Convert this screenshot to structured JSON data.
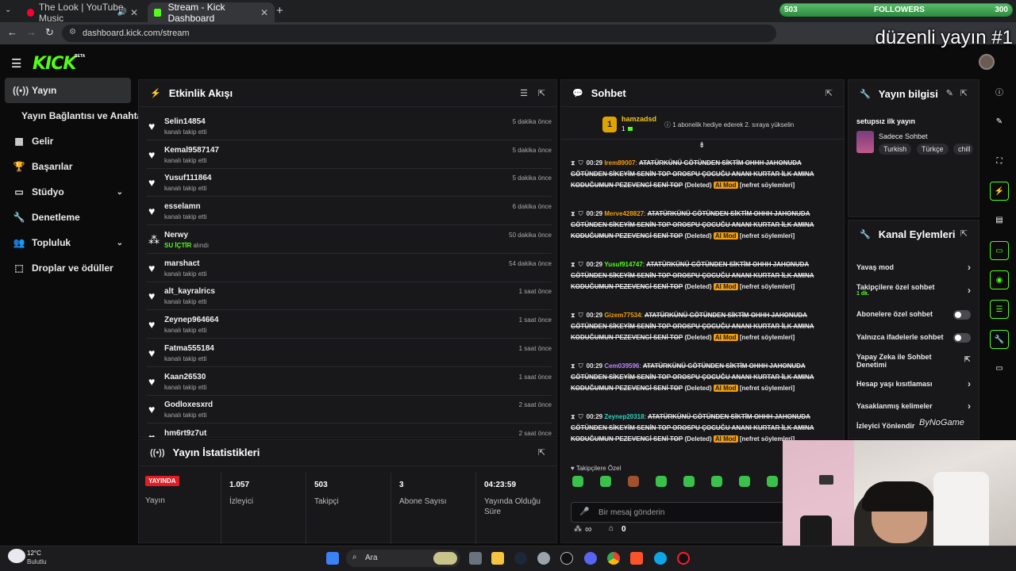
{
  "browser": {
    "tabs": [
      {
        "title": "The Look | YouTube Music"
      },
      {
        "title": "Stream - Kick Dashboard"
      }
    ],
    "url": "dashboard.kick.com/stream"
  },
  "overlay": {
    "followers_label": "FOLLOWERS",
    "followers_current": "503",
    "followers_goal": "300",
    "stream_title": "düzenli yayın #1",
    "watermark": "ByNoGame"
  },
  "kick": {
    "logo": "KICK",
    "beta": "BETA"
  },
  "sidebar": {
    "items": [
      {
        "label": "Yayın",
        "icon": "broadcast-icon"
      },
      {
        "label": "Yayın Bağlantısı ve Anahtarı",
        "icon": ""
      },
      {
        "label": "Gelir",
        "icon": "chart-icon"
      },
      {
        "label": "Başarılar",
        "icon": "trophy-icon"
      },
      {
        "label": "Stüdyo",
        "icon": "studio-icon"
      },
      {
        "label": "Denetleme",
        "icon": "wrench-icon"
      },
      {
        "label": "Topluluk",
        "icon": "community-icon"
      },
      {
        "label": "Droplar ve ödüller",
        "icon": "drops-icon"
      }
    ]
  },
  "activity": {
    "title": "Etkinlik Akışı",
    "items": [
      {
        "name": "Selin14854",
        "sub": "kanalı takip etti",
        "time": "5 dakika önce"
      },
      {
        "name": "Kemal9587147",
        "sub": "kanalı takip etti",
        "time": "5 dakika önce"
      },
      {
        "name": "Yusuf111864",
        "sub": "kanalı takip etti",
        "time": "5 dakika önce"
      },
      {
        "name": "esselamn",
        "sub": "kanalı takip etti",
        "time": "6 dakika önce"
      },
      {
        "name": "Nerwy",
        "highlight": "SU İÇTİR",
        "sub": "alındı",
        "time": "50 dakika önce"
      },
      {
        "name": "marshact",
        "sub": "kanalı takip etti",
        "time": "54 dakika önce"
      },
      {
        "name": "alt_kayralrics",
        "sub": "kanalı takip etti",
        "time": "1 saat önce"
      },
      {
        "name": "Zeynep964664",
        "sub": "kanalı takip etti",
        "time": "1 saat önce"
      },
      {
        "name": "Fatma555184",
        "sub": "kanalı takip etti",
        "time": "1 saat önce"
      },
      {
        "name": "Kaan26530",
        "sub": "kanalı takip etti",
        "time": "1 saat önce"
      },
      {
        "name": "Godloxesxrd",
        "sub": "kanalı takip etti",
        "time": "2 saat önce"
      },
      {
        "name": "hm6rt9z7ut",
        "sub": "",
        "time": "2 saat önce"
      }
    ]
  },
  "stats": {
    "title": "Yayın İstatistikleri",
    "live_badge": "YAYINDA",
    "live_label": "Yayın",
    "items": [
      {
        "value": "1.057",
        "label": "İzleyici"
      },
      {
        "value": "503",
        "label": "Takipçi"
      },
      {
        "value": "3",
        "label": "Abone Sayısı"
      },
      {
        "value": "04:23:59",
        "label": "Yayında Olduğu Süre"
      }
    ]
  },
  "chat": {
    "title": "Sohbet",
    "pinned_user": "hamzadsd",
    "pinned_rank": "1",
    "pinned_count": "1",
    "pinned_text": "1 abonelik hediye ederek 2. sıraya yükselin",
    "messages": [
      {
        "time": "00:29",
        "user": "Irem89007",
        "color": "#f59e0b",
        "text": "ATATÜRKÜNÜ GÖTÜNDEN SİKTİM OHHH JAHONUDA GÖTÜNDEN SİKEYİM SENİN TOP OROSPU ÇOCUĞU ANANI KURTAR İLK AMINA KODUĞUMUN PEZEVENGİ SENİ TOP"
      },
      {
        "time": "00:29",
        "user": "Merve428827",
        "color": "#f59e0b",
        "text": "ATATÜRKÜNÜ GÖTÜNDEN SİKTİM OHHH JAHONUDA GÖTÜNDEN SİKEYİM SENİN TOP OROSPU ÇOCUĞU ANANI KURTAR İLK AMINA KODUĞUMUN PEZEVENGİ SENİ TOP"
      },
      {
        "time": "00:29",
        "user": "Yusuf914747",
        "color": "#53fc18",
        "text": "ATATÜRKÜNÜ GÖTÜNDEN SİKTİM OHHH JAHONUDA GÖTÜNDEN SİKEYİM SENİN TOP OROSPU ÇOCUĞU ANANI KURTAR İLK AMINA KODUĞUMUN PEZEVENGİ SENİ TOP"
      },
      {
        "time": "00:29",
        "user": "Gizem77534",
        "color": "#f59e0b",
        "text": "ATATÜRKÜNÜ GÖTÜNDEN SİKTİM OHHH JAHONUDA GÖTÜNDEN SİKEYİM SENİN TOP OROSPU ÇOCUĞU ANANI KURTAR İLK AMINA KODUĞUMUN PEZEVENGİ SENİ TOP"
      },
      {
        "time": "00:29",
        "user": "Cem039596",
        "color": "#c084fc",
        "text": "ATATÜRKÜNÜ GÖTÜNDEN SİKTİM OHHH JAHONUDA GÖTÜNDEN SİKEYİM SENİN TOP OROSPU ÇOCUĞU ANANI KURTAR İLK AMINA KODUĞUMUN PEZEVENGİ SENİ TOP"
      },
      {
        "time": "00:29",
        "user": "Zeynep20318",
        "color": "#2dd4bf",
        "text": "ATATÜRKÜNÜ GÖTÜNDEN SİKTİM OHHH JAHONUDA GÖTÜNDEN SİKEYİM SENİN TOP OROSPU ÇOCUĞU ANANI KURTAR İLK AMINA KODUĞUMUN PEZEVENGİ SENİ TOP"
      }
    ],
    "deleted_label": "(Deleted)",
    "ai_label": "AI Mod",
    "reason_label": "[nefret söylemleri]",
    "followers_only": "Takipçilere Özel",
    "placeholder": "Bir mesaj gönderin",
    "infinity": "∞",
    "store_count": "0"
  },
  "stream_info": {
    "title": "Yayın bilgisi",
    "stream_name": "setupsız ilk yayın",
    "category": "Sadece Sohbet",
    "tags": [
      "Turkish",
      "Türkçe",
      "chill"
    ]
  },
  "channel_actions": {
    "title": "Kanal Eylemleri",
    "items": [
      {
        "label": "Yavaş mod",
        "type": "chevron"
      },
      {
        "label": "Takipçilere özel sohbet",
        "sub": "1 dk.",
        "type": "chevron"
      },
      {
        "label": "Abonelere özel sohbet",
        "type": "toggle"
      },
      {
        "label": "Yalnızca ifadelerle sohbet",
        "type": "toggle"
      },
      {
        "label": "Yapay Zeka ile Sohbet Denetimi",
        "type": "external"
      },
      {
        "label": "Hesap yaşı kısıtlaması",
        "type": "chevron"
      },
      {
        "label": "Yasaklanmış kelimeler",
        "type": "chevron"
      },
      {
        "label": "İzleyici Yönlendir",
        "type": "none"
      }
    ]
  },
  "taskbar": {
    "weather_temp": "12°C",
    "weather_desc": "Bulutlu",
    "search_placeholder": "Ara"
  },
  "colors": {
    "accent": "#53fc18",
    "panel": "#18181b",
    "bg": "#0b0b0c"
  }
}
